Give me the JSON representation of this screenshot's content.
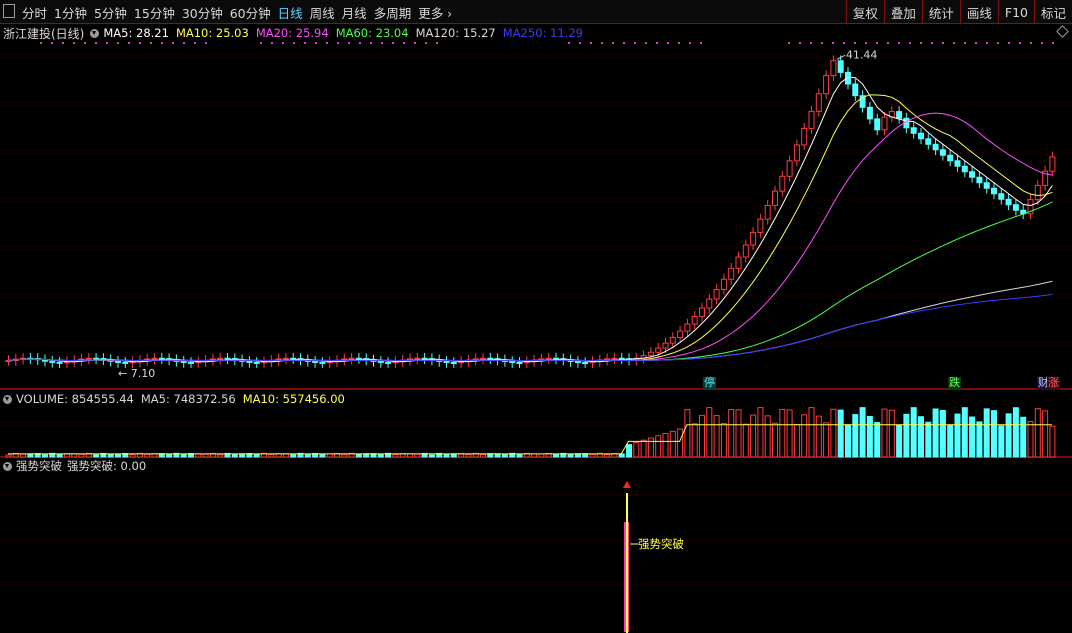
{
  "toolbar": {
    "periods": [
      "分时",
      "1分钟",
      "5分钟",
      "15分钟",
      "30分钟",
      "60分钟",
      "日线",
      "周线",
      "月线",
      "多周期",
      "更多"
    ],
    "active_period": "日线",
    "right_buttons": [
      "复权",
      "叠加",
      "统计",
      "画线",
      "F10",
      "标记"
    ]
  },
  "main_legend": {
    "stock": "浙江建投(日线)",
    "mas": [
      {
        "label": "MA5: 28.21",
        "color": "#ffffff"
      },
      {
        "label": "MA10: 25.03",
        "color": "#ffff4d"
      },
      {
        "label": "MA20: 25.94",
        "color": "#ff4dff"
      },
      {
        "label": "MA60: 23.04",
        "color": "#4dff4d"
      },
      {
        "label": "MA120: 15.27",
        "color": "#d8d8d8"
      },
      {
        "label": "MA250: 11.29",
        "color": "#3a3aff"
      }
    ]
  },
  "annotations": {
    "high": "41.44",
    "low": "7.10"
  },
  "flags": [
    {
      "text": "停",
      "color": "#5fe3e3",
      "bg": "#0a3a3a"
    },
    {
      "text": "跌",
      "color": "#5fff5f",
      "bg": "#0a3a0a"
    },
    {
      "text": "财",
      "color": "#c8c8ff",
      "bg": "#14143a"
    },
    {
      "text": "涨",
      "color": "#ff5f5f",
      "bg": "#3a0a0a"
    }
  ],
  "volume_legend": {
    "items": [
      {
        "label": "VOLUME: 854555.44",
        "color": "#d8d8d8"
      },
      {
        "label": "MA5: 748372.56",
        "color": "#d8d8d8"
      },
      {
        "label": "MA10: 557456.00",
        "color": "#ffff4d"
      }
    ]
  },
  "indicator_legend": {
    "name": "强势突破",
    "value": "强势突破: 0.00",
    "signal_label": "强势突破"
  },
  "colors": {
    "up": "#ff3c3c",
    "down": "#54ffff",
    "grid": "#5a0000"
  }
}
